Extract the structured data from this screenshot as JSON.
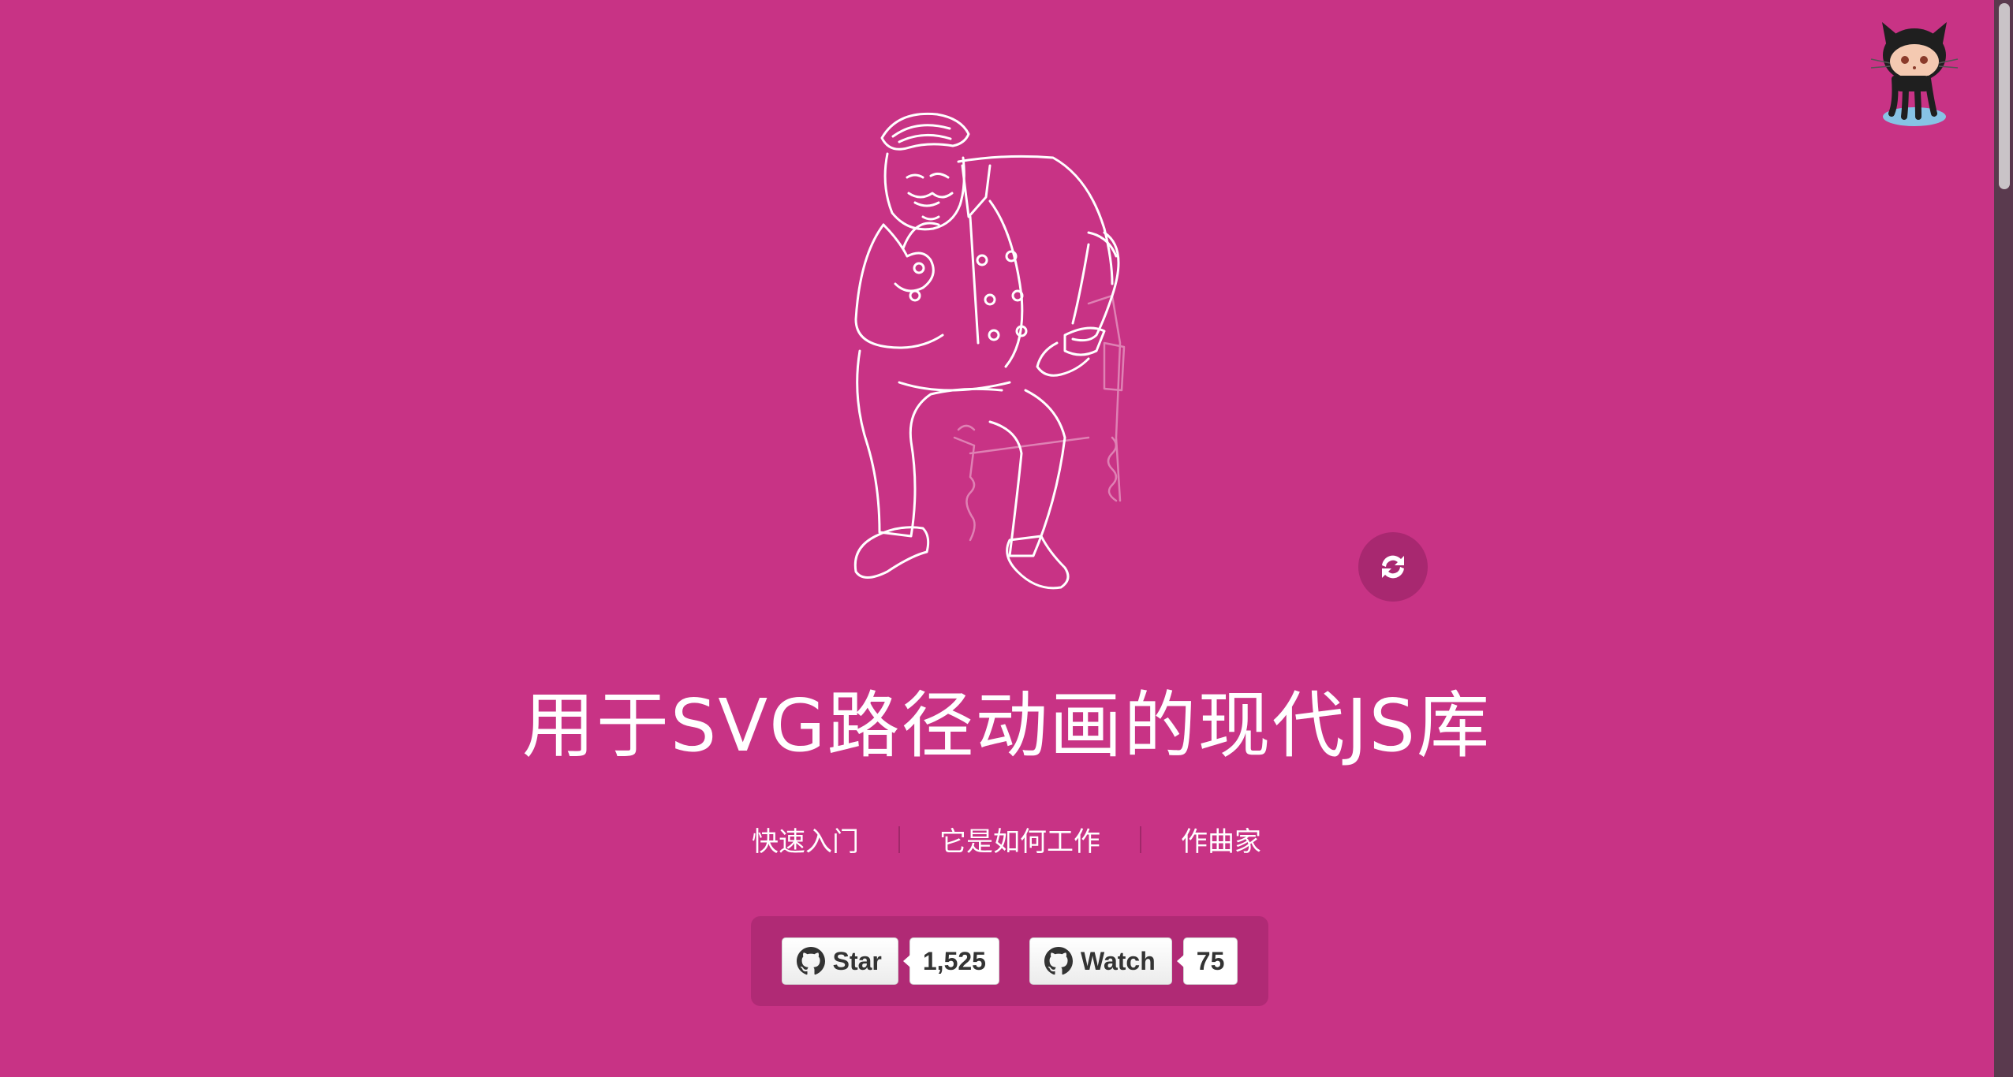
{
  "headline": "用于SVG路径动画的现代JS库",
  "nav": {
    "items": [
      {
        "label": "快速入门"
      },
      {
        "label": "它是如何工作"
      },
      {
        "label": "作曲家"
      }
    ]
  },
  "github": {
    "star_label": "Star",
    "star_count": "1,525",
    "watch_label": "Watch",
    "watch_count": "75"
  },
  "icons": {
    "corner": "octocat-icon",
    "replay": "replay-icon",
    "github": "github-mark-icon"
  },
  "colors": {
    "background": "#c83385",
    "panel": "#b02a75",
    "replay_button": "#a82870",
    "text": "#ffffff"
  }
}
